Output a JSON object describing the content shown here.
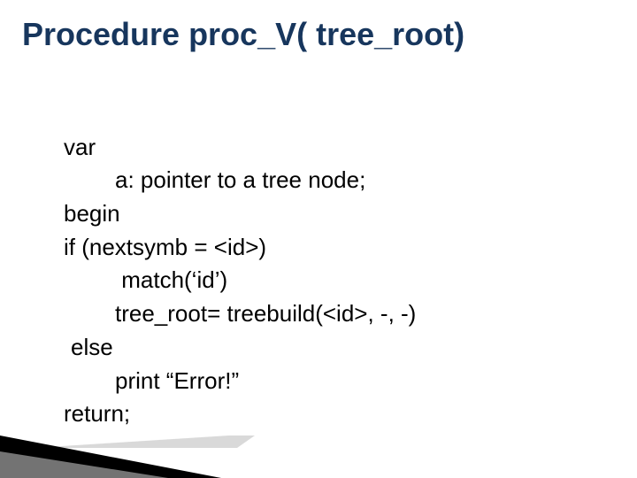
{
  "title": "Procedure proc_V( tree_root)",
  "lines": {
    "l0": "var",
    "l1": "a: pointer to a tree node;",
    "l2": "begin",
    "l3": "if (nextsymb = <id>)",
    "l4": " match(‘id’)",
    "l5": "tree_root= treebuild(<id>, -, -)",
    "l6": "else",
    "l7": "print “Error!”",
    "l8": "return;"
  }
}
